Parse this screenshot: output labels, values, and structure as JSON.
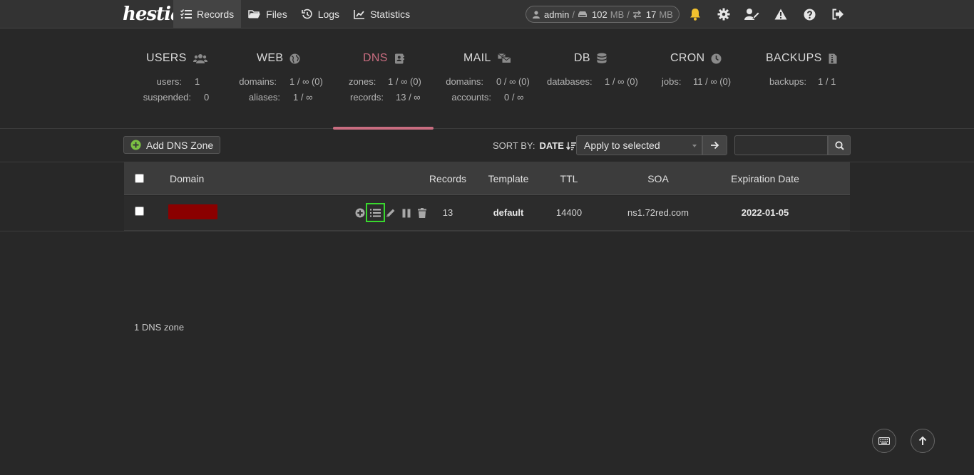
{
  "brand": {
    "logo_text": "hestia"
  },
  "nav": [
    {
      "label": "Records",
      "icon": "records-list-icon",
      "active": true
    },
    {
      "label": "Files",
      "icon": "folder-icon",
      "active": false
    },
    {
      "label": "Logs",
      "icon": "history-icon",
      "active": false
    },
    {
      "label": "Statistics",
      "icon": "chart-line-icon",
      "active": false
    }
  ],
  "user": {
    "name": "admin",
    "disk_value": "102",
    "disk_unit": "MB",
    "bandwidth_value": "17",
    "bandwidth_unit": "MB"
  },
  "top_icons": [
    "bell-icon",
    "gear-icon",
    "user-edit-icon",
    "warning-icon",
    "help-icon",
    "logout-icon"
  ],
  "colors": {
    "accent": "#c96d80",
    "bell": "#f2c12e",
    "highlight": "#39d92e",
    "redacted": "#8b0000",
    "add_icon": "#7bc043"
  },
  "stats": [
    {
      "title": "USERS",
      "icon": "users-icon",
      "rows": [
        {
          "k": "users:",
          "v": "1"
        },
        {
          "k": "suspended:",
          "v": "0"
        }
      ]
    },
    {
      "title": "WEB",
      "icon": "globe-icon",
      "rows": [
        {
          "k": "domains:",
          "v": "1 / ∞ (0)"
        },
        {
          "k": "aliases:",
          "v": "1 / ∞"
        }
      ]
    },
    {
      "title": "DNS",
      "icon": "address-book-icon",
      "active": true,
      "rows": [
        {
          "k": "zones:",
          "v": "1 / ∞ (0)"
        },
        {
          "k": "records:",
          "v": "13 / ∞"
        }
      ]
    },
    {
      "title": "MAIL",
      "icon": "mail-bulk-icon",
      "rows": [
        {
          "k": "domains:",
          "v": "0 / ∞ (0)"
        },
        {
          "k": "accounts:",
          "v": "0 / ∞"
        }
      ]
    },
    {
      "title": "DB",
      "icon": "database-icon",
      "rows": [
        {
          "k": "databases:",
          "v": "1 / ∞ (0)"
        }
      ]
    },
    {
      "title": "CRON",
      "icon": "clock-icon",
      "rows": [
        {
          "k": "jobs:",
          "v": "11 / ∞ (0)"
        }
      ]
    },
    {
      "title": "BACKUPS",
      "icon": "file-zip-icon",
      "rows": [
        {
          "k": "backups:",
          "v": "1 / 1"
        }
      ]
    }
  ],
  "toolbar": {
    "add_label": "Add DNS Zone",
    "sort_label": "SORT BY:",
    "sort_value": "DATE",
    "apply_select": "Apply to selected",
    "search_value": ""
  },
  "table": {
    "headers": {
      "domain": "Domain",
      "records": "Records",
      "template": "Template",
      "ttl": "TTL",
      "soa": "SOA",
      "expiration": "Expiration Date"
    },
    "rows": [
      {
        "domain": "",
        "records": "13",
        "template": "default",
        "ttl": "14400",
        "soa": "ns1.72red.com",
        "expiration": "2022-01-05"
      }
    ]
  },
  "footer": {
    "count": "1 DNS zone"
  }
}
